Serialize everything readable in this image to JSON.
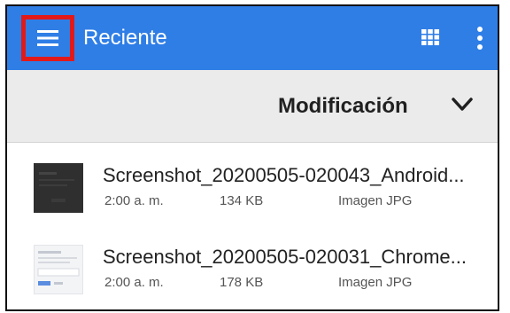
{
  "appbar": {
    "title": "Reciente",
    "menu_icon": "hamburger-menu-icon",
    "grid_icon": "grid-view-icon",
    "more_icon": "more-vert-icon",
    "background_color": "#2f7ee6",
    "highlight_color": "#e21919"
  },
  "sort": {
    "label": "Modificación",
    "icon": "chevron-down-icon"
  },
  "files": [
    {
      "name": "Screenshot_20200505-020043_Android...",
      "time": "2:00 a. m.",
      "size": "134 KB",
      "type": "Imagen JPG"
    },
    {
      "name": "Screenshot_20200505-020031_Chrome...",
      "time": "2:00 a. m.",
      "size": "178 KB",
      "type": "Imagen JPG"
    }
  ]
}
